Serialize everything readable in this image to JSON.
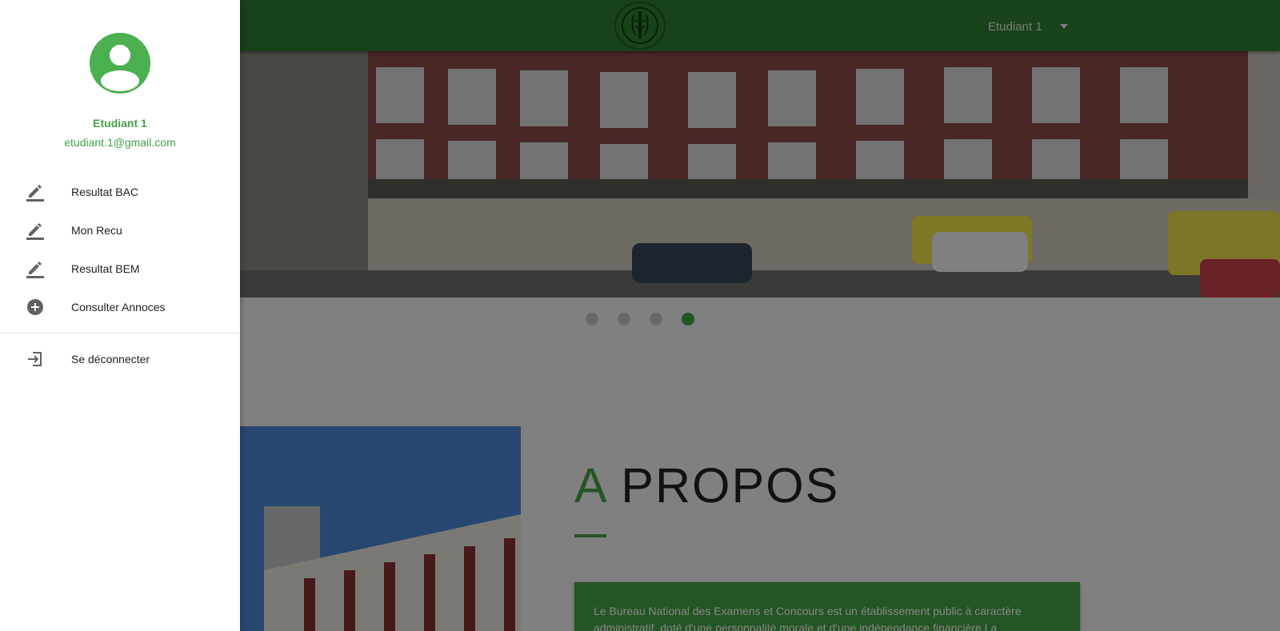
{
  "topbar": {
    "user_label": "Etudiant 1",
    "brand_color": "#2e7d32"
  },
  "carousel": {
    "slide_count": 4,
    "active_index": 3
  },
  "about": {
    "title_accent": "A",
    "title_rest": "PROPOS",
    "card_text": "Le Bureau National des Examens et Concours est un établissement public à caractère administratif, doté d'une personnalité morale et d'une indépendance financière La"
  },
  "drawer": {
    "name": "Etudiant 1",
    "email": "etudiant.1@gmail.com",
    "items": [
      {
        "label": "Resultat BAC",
        "icon": "pencil-icon"
      },
      {
        "label": "Mon Recu",
        "icon": "pencil-icon"
      },
      {
        "label": "Resultat BEM",
        "icon": "pencil-icon"
      },
      {
        "label": "Consulter Annoces",
        "icon": "add-circle-icon"
      }
    ],
    "logout": {
      "label": "Se déconnecter",
      "icon": "logout-icon"
    }
  },
  "colors": {
    "accent": "#43a047",
    "drawer_bg": "#ffffff",
    "overlay": "rgba(0,0,0,0.47)"
  }
}
